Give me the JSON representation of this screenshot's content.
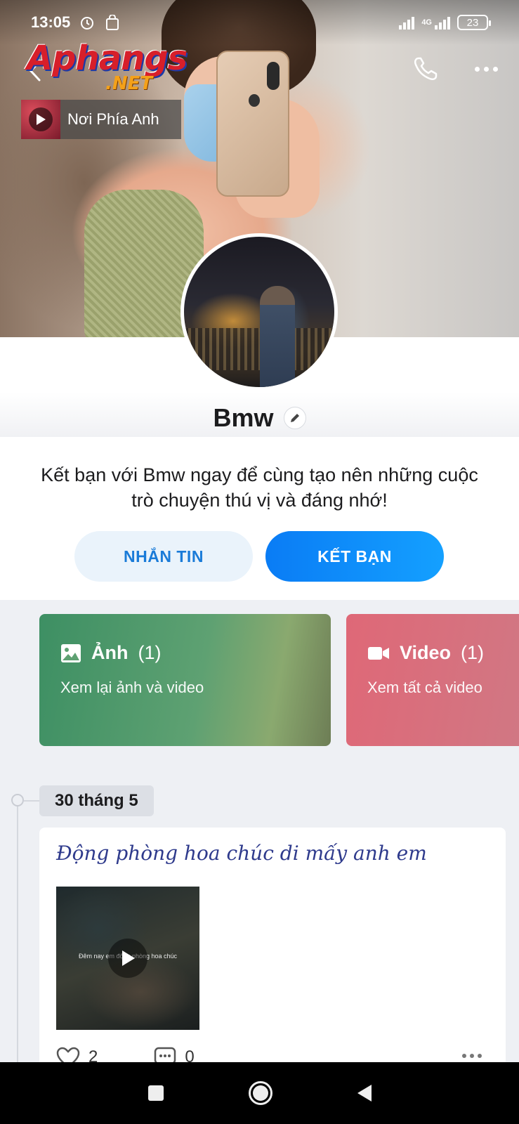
{
  "status_bar": {
    "time": "13:05",
    "network": "4G",
    "battery": "23"
  },
  "cover": {
    "watermark_main": "Aphangs",
    "watermark_sub": ".NET",
    "music_title": "Nơi Phía Anh"
  },
  "profile": {
    "name": "Bmw"
  },
  "friend_prompt": {
    "message": "Kết bạn với Bmw ngay để cùng tạo nên những cuộc trò chuyện thú vị và đáng nhớ!",
    "message_button": "NHẮN TIN",
    "add_friend_button": "KẾT BẠN"
  },
  "media": {
    "photos": {
      "label": "Ảnh",
      "count": "(1)",
      "subtitle": "Xem lại ảnh và video"
    },
    "videos": {
      "label": "Video",
      "count": "(1)",
      "subtitle": "Xem tất cả video"
    }
  },
  "timeline": {
    "date": "30 tháng 5",
    "post": {
      "caption": "Động phòng hoa chúc di mấy anh em",
      "video_overlay_text": "Đêm nay em động phòng hoa chúc",
      "likes": "2",
      "comments": "0"
    }
  },
  "colors": {
    "accent_blue": "#0a7cf5",
    "photo_tile": "#3d8f63",
    "video_tile": "#df6877"
  }
}
